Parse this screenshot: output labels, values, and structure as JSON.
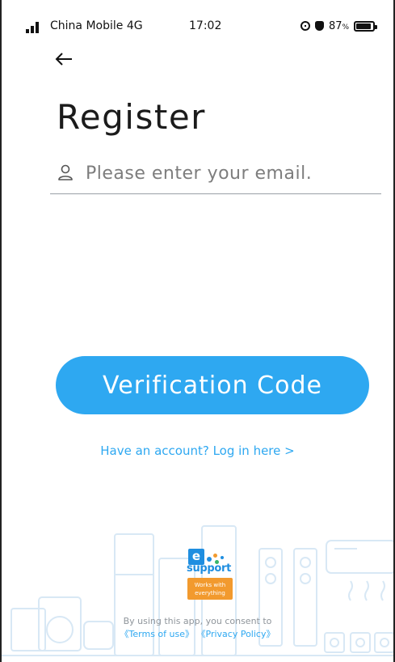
{
  "status_bar": {
    "carrier": "China Mobile 4G",
    "time": "17:02",
    "battery_pct": "87",
    "battery_suffix": "%",
    "battery_level": 0.87,
    "icons": [
      "signal-icon",
      "alarm-icon",
      "shield-icon",
      "battery-icon"
    ]
  },
  "nav": {
    "back_icon": "arrow-left-icon"
  },
  "page": {
    "title": "Register"
  },
  "email": {
    "icon": "user-icon",
    "placeholder": "Please enter your email.",
    "value": ""
  },
  "actions": {
    "verify_label": "Verification Code",
    "login_link": "Have an account? Log in here >"
  },
  "brand": {
    "logo_letter": "e",
    "logo_word": "support",
    "badge_line1": "Works with",
    "badge_line2": "everything"
  },
  "footer": {
    "consent_text": "By using this app, you consent to",
    "terms_label": "《Terms of use》",
    "privacy_label": "《Privacy Policy》"
  },
  "colors": {
    "accent": "#2ea8f1",
    "brand_blue": "#1f8ee0",
    "brand_orange": "#f29a2e",
    "art_outline": "#d8e8f5"
  }
}
